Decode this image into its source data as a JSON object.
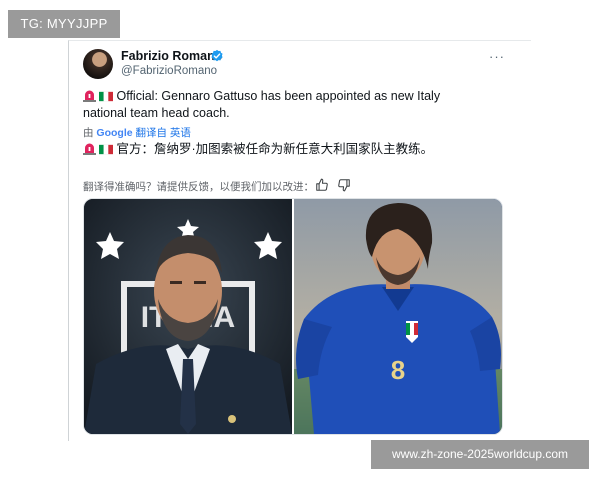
{
  "watermarks": {
    "top": "TG: MYYJJPP",
    "bottom": "www.zh-zone-2025worldcup.com"
  },
  "post": {
    "author_name": "Fabrizio Romano",
    "author_handle": "@FabrizioRomano",
    "verified": true,
    "more_label": "···",
    "text_en_1": "Official: Gennaro Gattuso has been appointed as new Italy",
    "text_en_2": "national team head coach.",
    "translate_prefix": "由",
    "translate_brand": "Google",
    "translate_label": "翻译自 英语",
    "text_zh": "官方：詹纳罗·加图索被任命为新任意大利国家队主教练。",
    "feedback_text": "翻译得准确吗？请提供反馈，以便我们加以改进：",
    "icons": [
      "siren-icon",
      "italy-flag-icon",
      "verified-icon",
      "thumbs-up-icon",
      "thumbs-down-icon"
    ],
    "colors": {
      "verified": "#1d9bf0",
      "italy_green": "#009246",
      "italy_white": "#ffffff",
      "italy_red": "#ce2b37"
    }
  },
  "media": {
    "left_image": "Gattuso in suit before ITALIA crest with stars",
    "right_image": "Gattuso in Italy blue jersey number 8",
    "jersey_number": "8",
    "crest_text": "ITALIA"
  }
}
